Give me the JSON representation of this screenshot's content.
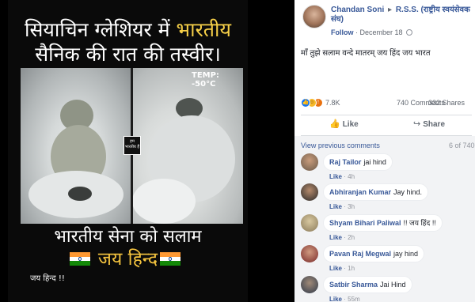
{
  "image": {
    "title_line1_prefix": "सियाचिन ग्लेशियर में ",
    "title_line1_highlight": "भारतीय",
    "title_line2": "सैनिक की रात की तस्वीर।",
    "temperature": "TEMP: -50°C",
    "watermark": "हम भारतीय हैं",
    "salute": "भारतीय सेना को सलाम",
    "jai_hind": "जय हिन्द",
    "caption": "जय हिन्द !!"
  },
  "post": {
    "author": "Chandan Soni",
    "arrow": "▸",
    "group": "R.S.S. (राष्ट्रीय स्वयंसेवक संघ)",
    "follow_label": "Follow",
    "dot": " · ",
    "date": "December 18",
    "text": "माँ तुझे सलाम वन्दे मातरम् जय हिंद जय भारत",
    "reaction_count": "7.8K",
    "comment_count": "740 Comments",
    "share_count": "332 Shares",
    "like_label": "Like",
    "share_label": "Share",
    "reaction_icons": [
      "like-icon",
      "haha-icon",
      "angry-icon"
    ],
    "like_color": "#1877f2"
  },
  "comments_section": {
    "view_previous": "View previous comments",
    "page_count": "6 of 740",
    "comments": [
      {
        "name": "Raj Tailor",
        "text": "jai hind",
        "like": "Like",
        "time": "4h",
        "avatar_color": "#6a5a4a"
      },
      {
        "name": "Abhiranjan Kumar",
        "text": "Jay hind.",
        "like": "Like",
        "time": "3h",
        "avatar_color": "#3a3a3a"
      },
      {
        "name": "Shyam Bihari Paliwal",
        "text": "!! जय हिंद !!",
        "like": "Like",
        "time": "2h",
        "avatar_color": "#8a7a5a"
      },
      {
        "name": "Pavan Raj Megwal",
        "text": "jay hind",
        "like": "Like",
        "time": "1h",
        "avatar_color": "#7a2a2a"
      },
      {
        "name": "Satbir Sharma",
        "text": "Jai Hind",
        "like": "Like",
        "time": "55m",
        "avatar_color": "#2f3a4a"
      }
    ]
  }
}
